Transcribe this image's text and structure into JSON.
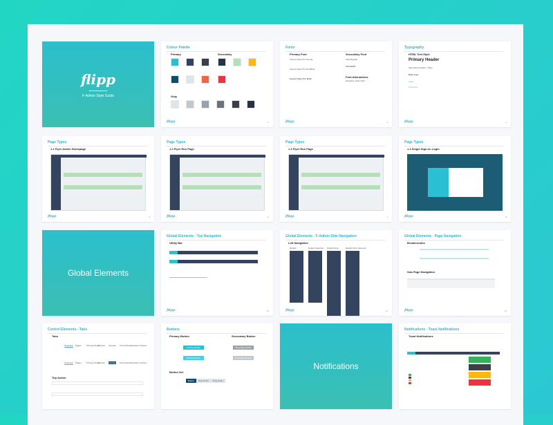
{
  "footer": "F-Admin Style Guide",
  "cover": {
    "logo": "flipp",
    "title": "F-Admin Style Guide"
  },
  "colour_palette": {
    "title": "Colour Palette",
    "primary": "Primary",
    "secondary": "Secondary",
    "gray": "Gray",
    "page": "2",
    "primary_colors": [
      "#2bbfd4",
      "#34445e",
      "#3b4048",
      "#0e4d6e",
      "#dde4ea",
      "#f26445"
    ],
    "secondary_colors": [
      "#253545",
      "#b5dfb9",
      "#fdb614",
      "#ee3340"
    ],
    "gray_colors": [
      "#dde4ea",
      "#c2c7cb",
      "#9aa3ab",
      "#6a737b",
      "#3b4048",
      "#2a3240"
    ]
  },
  "fonts": {
    "title": "Fonts",
    "primary": "Primary Font",
    "secondary": "Secondary Font",
    "p1": "Source Sans Pro Normal",
    "p2": "Source Sans Pro SemiBold",
    "p3": "Source Sans Pro Bold",
    "s1": "Arial Regular",
    "s2": "Arial Bold",
    "alt": "Font Alternatives",
    "alt_val": "Helvetica, Sans Serif",
    "page": "3"
  },
  "typography": {
    "title": "Typography",
    "html": "HTML Text Style",
    "primary": "Primary Header",
    "secondary": "Secondary Header / Titles",
    "body": "Body Copy",
    "links": "Links",
    "footnotes": "Footnotes",
    "page": "4"
  },
  "page_types": [
    {
      "title": "Page Types",
      "sub": "1.1 Flyer Admin Homepage",
      "page": "5"
    },
    {
      "title": "Page Types",
      "sub": "1.2 Flyer Run Page",
      "page": "6"
    },
    {
      "title": "Page Types",
      "sub": "1.3 Flyer Run Page",
      "page": "7"
    },
    {
      "title": "Page Types",
      "sub": "1.3 Single Sign-on Login",
      "page": "8"
    }
  ],
  "global": {
    "title": "Global Elements"
  },
  "top_nav": {
    "title": "Global Elements - Top Navigation",
    "sub": "Utility Bar",
    "page": "10"
  },
  "side_nav": {
    "title": "Global Elements - F-Admin Side Navigation",
    "sub": "Left Navigation",
    "cols": [
      "Default",
      "Default Selected",
      "Default Drop",
      "Default Drop Selected"
    ],
    "page": "11"
  },
  "page_nav": {
    "title": "Global Elements - Page Navigation",
    "sub1": "Breadcrumbs",
    "sub2": "Sub-Page Navigation",
    "page": "12"
  },
  "tabs": {
    "title": "Control Elements - Tabs",
    "sub1": "Tabs",
    "sub2": "Top Action",
    "items": [
      "Overview",
      "Pages",
      "Pricing Zones",
      "Variants",
      "Vendors",
      "Cross Route",
      "Operator Content"
    ]
  },
  "buttons": {
    "title": "Buttons",
    "primary": "Primary Button",
    "secondary": "Secondary Button",
    "primary_label": "Primary Button",
    "secondary_label": "Secondary Button",
    "set": "Button Set",
    "set_items": [
      "Button",
      "Drop Down",
      "Drop Down"
    ]
  },
  "notifications": {
    "title": "Notifications"
  },
  "toast": {
    "title": "Notifications - Toast Notifications",
    "sub": "Toast Notifications",
    "colors": [
      "#36b05a",
      "#3b4048",
      "#fdb614",
      "#ee3340"
    ]
  }
}
